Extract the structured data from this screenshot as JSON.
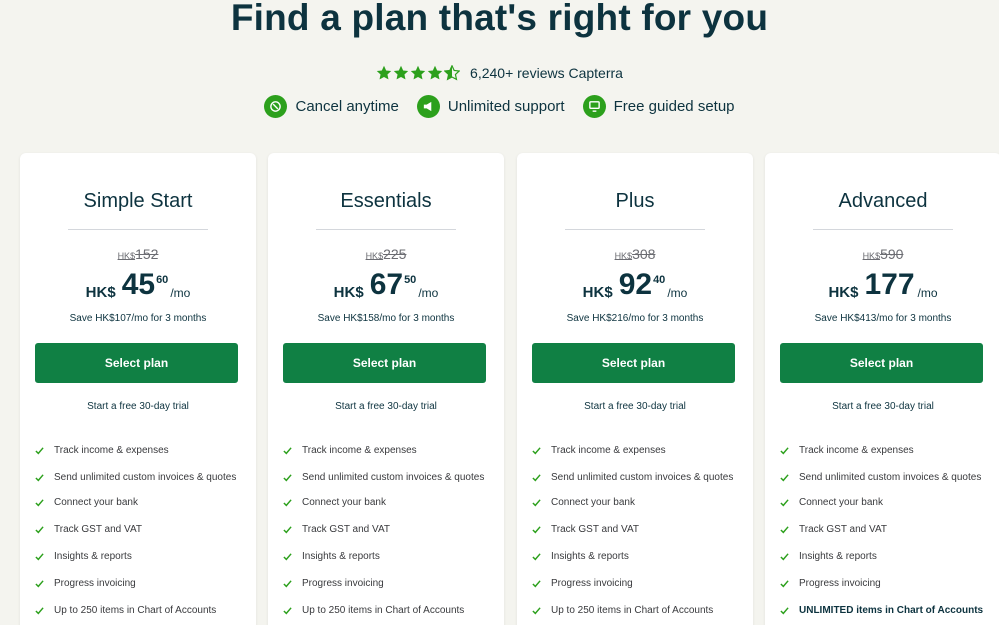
{
  "headline": "Find a plan that's right for you",
  "rating": {
    "stars": 4.5,
    "text": "6,240+ reviews Capterra",
    "star_color": "#2ca01c"
  },
  "badges": [
    {
      "icon": "cancel-icon",
      "label": "Cancel anytime"
    },
    {
      "icon": "megaphone-icon",
      "label": "Unlimited support"
    },
    {
      "icon": "setup-icon",
      "label": "Free guided setup"
    }
  ],
  "colors": {
    "brand_green": "#2ca01c",
    "button_green": "#108044",
    "text_dark": "#0d333f"
  },
  "plans": [
    {
      "name": "Simple Start",
      "old_currency": "HK$",
      "old_amount": "152",
      "currency": "HK$",
      "price_main": "45",
      "price_cents": "60",
      "per": "/mo",
      "savings": "Save HK$107/mo for 3 months",
      "button": "Select plan",
      "trial": "Start a free 30-day trial",
      "features": [
        "Track income & expenses",
        "Send unlimited custom invoices & quotes",
        "Connect your bank",
        "Track GST and VAT",
        "Insights & reports",
        "Progress invoicing",
        "Up to 250 items in Chart of Accounts"
      ]
    },
    {
      "name": "Essentials",
      "old_currency": "HK$",
      "old_amount": "225",
      "currency": "HK$",
      "price_main": "67",
      "price_cents": "50",
      "per": "/mo",
      "savings": "Save HK$158/mo for 3 months",
      "button": "Select plan",
      "trial": "Start a free 30-day trial",
      "features": [
        "Track income & expenses",
        "Send unlimited custom invoices & quotes",
        "Connect your bank",
        "Track GST and VAT",
        "Insights & reports",
        "Progress invoicing",
        "Up to 250 items in Chart of Accounts"
      ]
    },
    {
      "name": "Plus",
      "old_currency": "HK$",
      "old_amount": "308",
      "currency": "HK$",
      "price_main": "92",
      "price_cents": "40",
      "per": "/mo",
      "savings": "Save HK$216/mo for 3 months",
      "button": "Select plan",
      "trial": "Start a free 30-day trial",
      "features": [
        "Track income & expenses",
        "Send unlimited custom invoices & quotes",
        "Connect your bank",
        "Track GST and VAT",
        "Insights & reports",
        "Progress invoicing",
        "Up to 250 items in Chart of Accounts"
      ]
    },
    {
      "name": "Advanced",
      "old_currency": "HK$",
      "old_amount": "590",
      "currency": "HK$",
      "price_main": "177",
      "price_cents": "",
      "per": "/mo",
      "savings": "Save HK$413/mo for 3 months",
      "button": "Select plan",
      "trial": "Start a free 30-day trial",
      "features": [
        "Track income & expenses",
        "Send unlimited custom invoices & quotes",
        "Connect your bank",
        "Track GST and VAT",
        "Insights & reports",
        "Progress invoicing",
        "UNLIMITED items in Chart of Accounts"
      ]
    }
  ]
}
